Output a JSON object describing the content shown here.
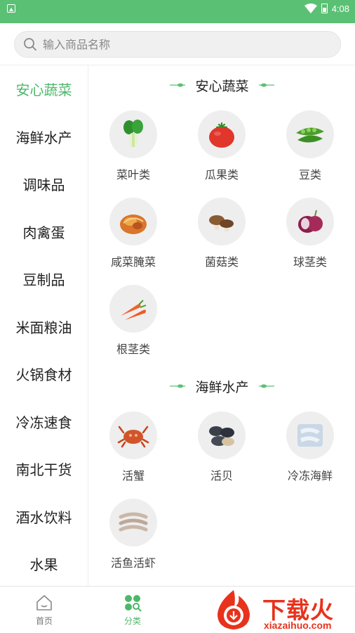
{
  "status_bar": {
    "time": "4:08"
  },
  "search": {
    "placeholder": "输入商品名称"
  },
  "sidebar": {
    "items": [
      {
        "label": "安心蔬菜",
        "active": true
      },
      {
        "label": "海鲜水产"
      },
      {
        "label": "调味品"
      },
      {
        "label": "肉禽蛋"
      },
      {
        "label": "豆制品"
      },
      {
        "label": "米面粮油"
      },
      {
        "label": "火锅食材"
      },
      {
        "label": "冷冻速食"
      },
      {
        "label": "南北干货"
      },
      {
        "label": "酒水饮料"
      },
      {
        "label": "水果"
      }
    ]
  },
  "sections": [
    {
      "title": "安心蔬菜",
      "items": [
        {
          "label": "菜叶类",
          "icon": "bok-choy-icon"
        },
        {
          "label": "瓜果类",
          "icon": "tomato-icon"
        },
        {
          "label": "豆类",
          "icon": "pea-pod-icon"
        },
        {
          "label": "咸菜腌菜",
          "icon": "kimchi-icon"
        },
        {
          "label": "菌菇类",
          "icon": "mushroom-icon"
        },
        {
          "label": "球茎类",
          "icon": "onion-icon"
        },
        {
          "label": "根茎类",
          "icon": "carrot-icon"
        }
      ]
    },
    {
      "title": "海鲜水产",
      "items": [
        {
          "label": "活蟹",
          "icon": "crab-icon"
        },
        {
          "label": "活贝",
          "icon": "clam-icon"
        },
        {
          "label": "冷冻海鲜",
          "icon": "frozen-fish-icon"
        },
        {
          "label": "活鱼活虾",
          "icon": "shrimp-icon"
        }
      ]
    }
  ],
  "bottom_nav": {
    "items": [
      {
        "label": "首页",
        "icon": "home-icon"
      },
      {
        "label": "分类",
        "icon": "category-icon",
        "active": true
      }
    ]
  },
  "watermark": {
    "title": "下载火",
    "subtitle": "xiazaihuo.com"
  },
  "colors": {
    "accent": "#4cb86a",
    "status_bar": "#5ac174",
    "watermark": "#e8321c"
  }
}
